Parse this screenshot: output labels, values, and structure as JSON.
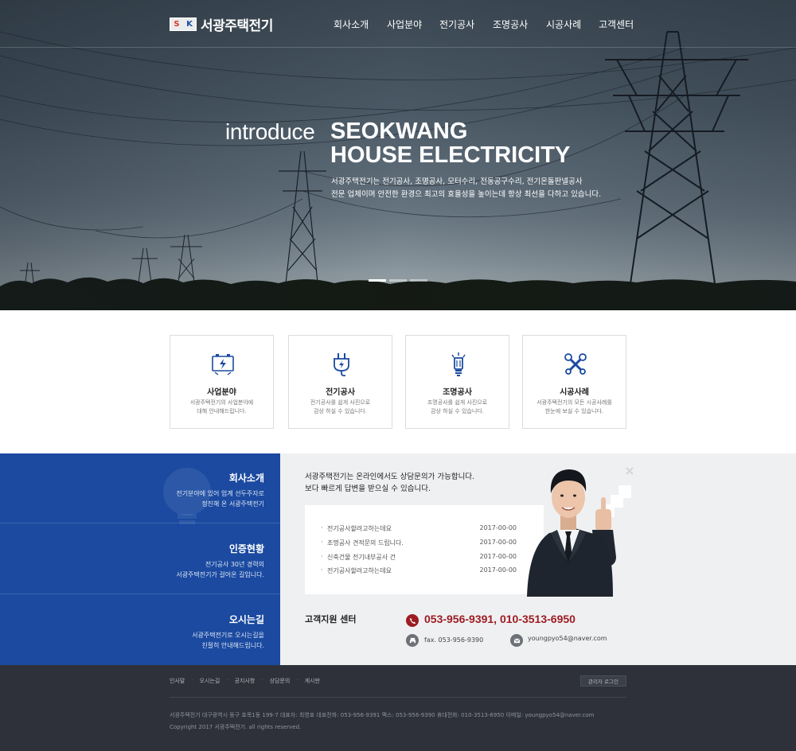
{
  "header": {
    "logo_mark": {
      "s": "S",
      "k": "K"
    },
    "logo_text": "서광주택전기",
    "nav": [
      "회사소개",
      "사업분야",
      "전기공사",
      "조명공사",
      "시공사례",
      "고객센터"
    ]
  },
  "hero": {
    "title_light": "introduce",
    "title_line1": "SEOKWANG",
    "title_line2": "HOUSE ELECTRICITY",
    "desc_line1": "서광주택전기는 전기공사, 조명공사, 모터수리, 전동공구수리, 전기온돌판넬공사",
    "desc_line2": "전문 업체이며 안전한 환경으 최고의 효율성을 높이는데 항상 최선을 다하고 있습니다.",
    "slide_count": 3,
    "active_slide": 1
  },
  "services": [
    {
      "icon": "electric-panel-icon",
      "title": "사업분야",
      "desc1": "서광주택전기의 사업분야에",
      "desc2": "대해 안내해드립니다."
    },
    {
      "icon": "electric-plug-icon",
      "title": "전기공사",
      "desc1": "전기공사를 쉽게 사진으로",
      "desc2": "감상 하실 수 있습니다."
    },
    {
      "icon": "light-bulb-icon",
      "title": "조명공사",
      "desc1": "조명공사를 쉽게 사진으로",
      "desc2": "감상 하실 수 있습니다."
    },
    {
      "icon": "tools-icon",
      "title": "시공사례",
      "desc1": "서광주택전기의 모든 시공사례를",
      "desc2": "한눈에 보실 수 있습니다."
    }
  ],
  "side_menu": [
    {
      "title": "회사소개",
      "desc1": "전기분야에 있어 업계 선두주자로",
      "desc2": "정진해 온 서광주택전기"
    },
    {
      "title": "인증현황",
      "desc1": "전기공사 30년 경력의",
      "desc2": "서광주택전기가 걸어온 길입니다."
    },
    {
      "title": "오시는길",
      "desc1": "서광주택전기로 오시는길을",
      "desc2": "친절히 안내해드립니다."
    }
  ],
  "consult": {
    "intro_line1": "서광주택전기는 온라인에서도 상담문의가 가능합니다.",
    "intro_line2": "보다 빠르게 답변을 받으실 수 있습니다.",
    "notices": [
      {
        "title": "전기공사할려고하는데요",
        "date": "2017-00-00"
      },
      {
        "title": "조명공사 견적문의 드립니다.",
        "date": "2017-00-00"
      },
      {
        "title": "신축건물 전기내부공사 건",
        "date": "2017-00-00"
      },
      {
        "title": "전기공사할려고하는데요",
        "date": "2017-00-00"
      }
    ],
    "cs_label": "고객지원 센터",
    "phones": "053-956-9391, 010-3513-6950",
    "fax": "fax. 053-956-9390",
    "email": "youngpyo54@naver.com"
  },
  "footer": {
    "links": [
      "인사말",
      "오시는길",
      "공지사항",
      "상담문의",
      "게시판"
    ],
    "admin_login": "관리자 로그인",
    "info": "서광주택전기    대구광역시 동구 효목1동 199-7    대표자: 최영표    대표전화: 053-956-9391    팩스: 053-956-9390    휴대전화: 010-3513-6950    이메일: youngpyo54@naver.com",
    "copyright": "Copyright 2017 서광주택전기. all rights reserved."
  },
  "colors": {
    "blue": "#1b4aa0",
    "red": "#9d1c22",
    "footer": "#2e3139",
    "gray_bg": "#eff0f2"
  }
}
